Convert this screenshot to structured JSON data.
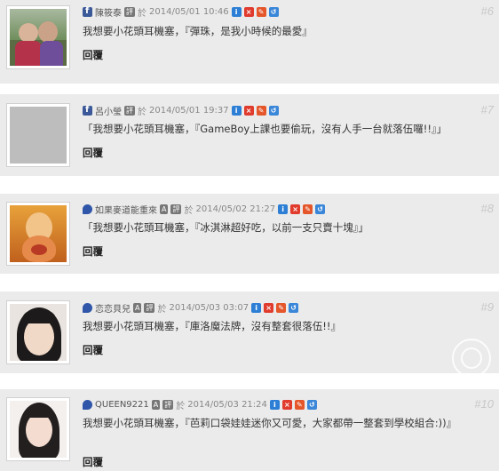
{
  "comments": [
    {
      "number": "#6",
      "author": "陳筱泰",
      "badges": [
        "評"
      ],
      "posted_prefix": "於",
      "datetime": "2014/05/01 10:46",
      "source_icon": "facebook-icon",
      "text": "我想要小花頭耳機塞，『彈珠，是我小時候的最愛』",
      "reply_label": "回覆"
    },
    {
      "number": "#7",
      "author": "呂小瑩",
      "badges": [
        "評"
      ],
      "posted_prefix": "於",
      "datetime": "2014/05/01 19:37",
      "source_icon": "facebook-icon",
      "text": "「我想要小花頭耳機塞，『GameBoy上課也要偷玩，沒有人手一台就落伍囉!!』」",
      "reply_label": "回覆"
    },
    {
      "number": "#8",
      "author": "如果麥道能重來",
      "badges": [
        "A",
        "評"
      ],
      "posted_prefix": "於",
      "datetime": "2014/05/02 21:27",
      "source_icon": "comment-bubble-icon",
      "text": "「我想要小花頭耳機塞，『冰淇淋超好吃，以前一支只賣十塊』」",
      "reply_label": "回覆"
    },
    {
      "number": "#9",
      "author": "恋恋貝兒",
      "badges": [
        "A",
        "評"
      ],
      "posted_prefix": "於",
      "datetime": "2014/05/03 03:07",
      "source_icon": "comment-bubble-icon",
      "text": "我想要小花頭耳機塞，『庫洛魔法牌，沒有整套很落伍!!』",
      "reply_label": "回覆"
    },
    {
      "number": "#10",
      "author": "QUEEN9221",
      "badges": [
        "A",
        "評"
      ],
      "posted_prefix": "於",
      "datetime": "2014/05/03 21:24",
      "source_icon": "comment-bubble-icon",
      "text": "我想要小花頭耳機塞，『芭莉口袋娃娃迷你又可愛，大家都帶一整套到學校組合:))』",
      "reply_label": "回覆"
    }
  ],
  "action_icons": [
    "info-icon",
    "delete-icon",
    "edit-icon",
    "reply-icon"
  ]
}
